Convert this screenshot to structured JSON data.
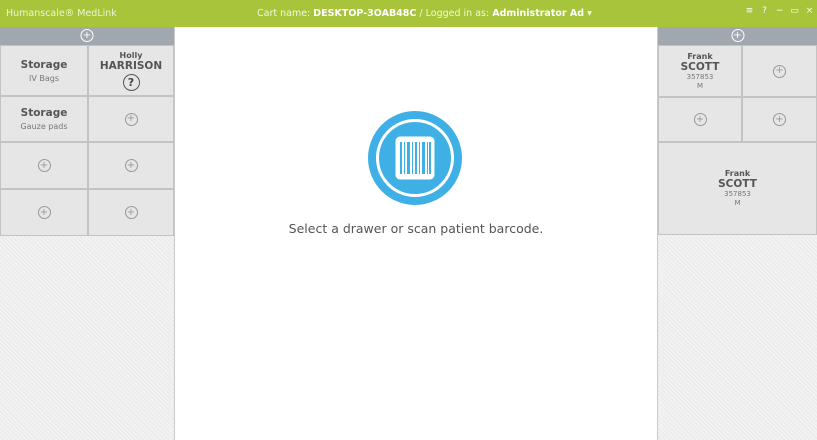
{
  "titlebar": {
    "app_name": "Humanscale® MedLink",
    "cart_label": "Cart name:",
    "cart_name": "DESKTOP-3OAB48C",
    "separator": "/",
    "logged_label": "Logged in as:",
    "user": "Administrator Ad",
    "user_caret": "▾",
    "controls": [
      "≡",
      "?",
      "−",
      "▭",
      "×"
    ]
  },
  "left_panel": {
    "header_icon": "+",
    "cells": [
      {
        "type": "storage",
        "title": "Storage",
        "sub": "IV Bags"
      },
      {
        "type": "patient",
        "first": "Holly",
        "last": "HARRISON",
        "icon": "?"
      },
      {
        "type": "storage",
        "title": "Storage",
        "sub": "Gauze pads"
      },
      {
        "type": "empty",
        "icon": "+"
      },
      {
        "type": "empty",
        "icon": "+"
      },
      {
        "type": "empty",
        "icon": "+"
      },
      {
        "type": "empty",
        "icon": "+"
      },
      {
        "type": "empty",
        "icon": "+"
      }
    ]
  },
  "right_panel": {
    "header_icon": "+",
    "cells": [
      {
        "type": "patient",
        "first": "Frank",
        "last": "SCOTT",
        "id": "357853",
        "sex": "M"
      },
      {
        "type": "empty",
        "icon": "+"
      },
      {
        "type": "empty",
        "icon": "+"
      },
      {
        "type": "empty",
        "icon": "+"
      },
      {
        "type": "patient",
        "first": "Frank",
        "last": "SCOTT",
        "id": "357853",
        "sex": "M"
      }
    ]
  },
  "center": {
    "scan_icon": "barcode-icon",
    "prompt": "Select a drawer or scan patient barcode."
  },
  "colors": {
    "titlebar": "#a7c43a",
    "accent_blue": "#3fb0e6",
    "panel_header": "#a1a7af"
  }
}
